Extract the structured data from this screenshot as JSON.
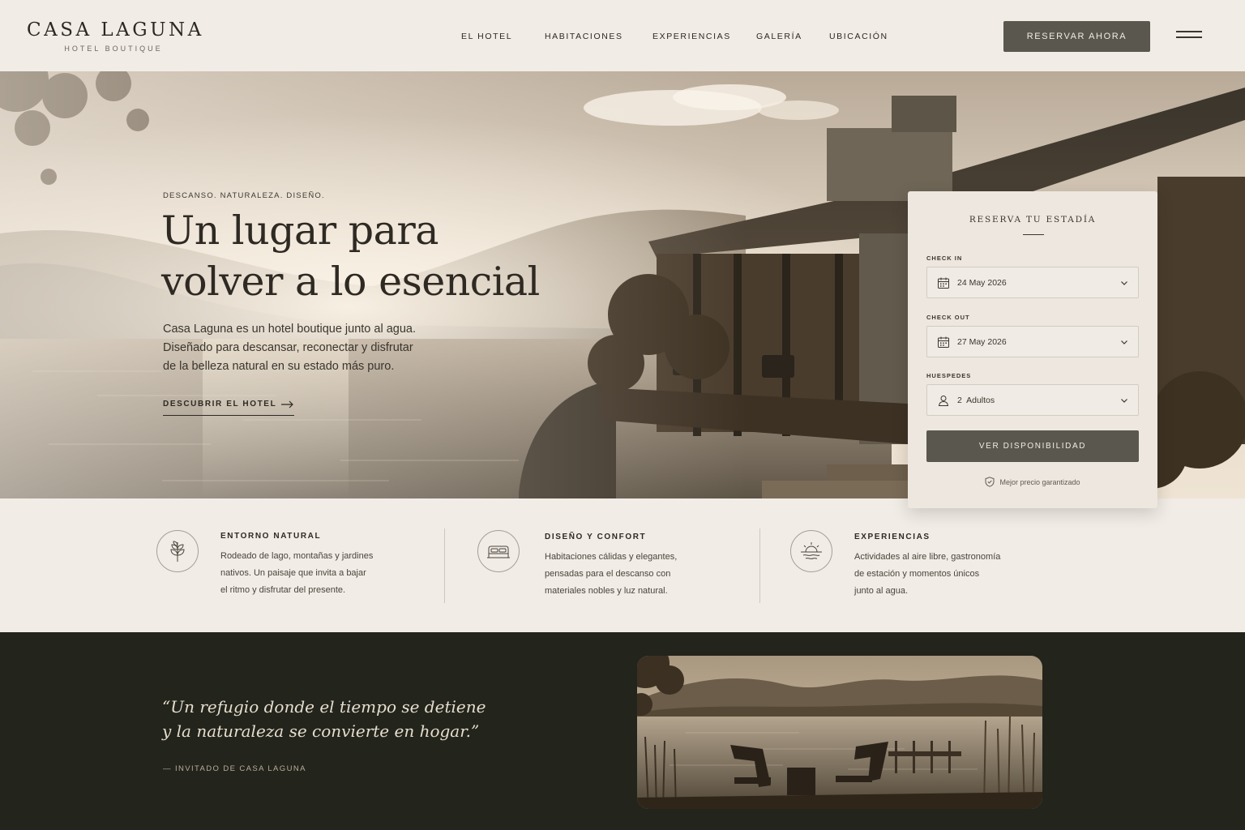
{
  "brand": {
    "name": "CASA LAGUNA",
    "tagline": "HOTEL BOUTIQUE"
  },
  "nav": {
    "items": [
      {
        "label": "EL HOTEL"
      },
      {
        "label": "HABITACIONES"
      },
      {
        "label": "EXPERIENCIAS"
      },
      {
        "label": "GALERÍA"
      },
      {
        "label": "UBICACIÓN"
      }
    ],
    "cta_label": "RESERVAR AHORA",
    "menu_icon": "hamburger-menu-icon"
  },
  "hero": {
    "eyebrow": "DESCANSO. NATURALEZA. DISEÑO.",
    "title_lines": [
      "Un lugar para",
      "volver a lo esencial"
    ],
    "description_lines": [
      "Casa Laguna es un hotel boutique junto al agua.",
      "Diseñado para descansar, reconectar y disfrutar",
      "de la belleza natural en su estado más puro."
    ],
    "link_label": "DESCUBRIR EL HOTEL",
    "link_icon": "arrow-right-icon"
  },
  "booking": {
    "title": "RESERVA TU ESTADÍA",
    "check_in": {
      "label": "CHECK IN",
      "value": "24 May 2026",
      "icon": "calendar-icon"
    },
    "check_out": {
      "label": "CHECK OUT",
      "value": "27 May 2026",
      "icon": "calendar-icon"
    },
    "guests": {
      "label": "HUESPEDES",
      "value": "2  Adultos",
      "icon": "user-icon"
    },
    "submit_label": "VER DISPONIBILIDAD",
    "guarantee": "Mejor precio garantizado",
    "guarantee_icon": "shield-check-icon"
  },
  "features": [
    {
      "icon": "leaf-icon",
      "title": "ENTORNO NATURAL",
      "lines": [
        "Rodeado de lago, montañas y jardines",
        "nativos. Un paisaje que invita a bajar",
        "el ritmo y disfrutar del presente."
      ]
    },
    {
      "icon": "bed-icon",
      "title": "DISEÑO Y CONFORT",
      "lines": [
        "Habitaciones cálidas y elegantes,",
        "pensadas para el descanso con",
        "materiales nobles y luz natural."
      ]
    },
    {
      "icon": "sunset-icon",
      "title": "EXPERIENCIAS",
      "lines": [
        "Actividades al aire libre, gastronomía",
        "de estación y momentos únicos",
        "junto al agua."
      ]
    }
  ],
  "testimonial": {
    "quote_lines": [
      "“Un refugio donde el tiempo se detiene",
      "y la naturaleza se convierte en hogar.”"
    ],
    "author": "— INVITADO DE CASA LAGUNA"
  },
  "colors": {
    "background": "#f1ece6",
    "button": "#5a574e",
    "dark_band": "#23241b",
    "text": "#2b2822"
  }
}
